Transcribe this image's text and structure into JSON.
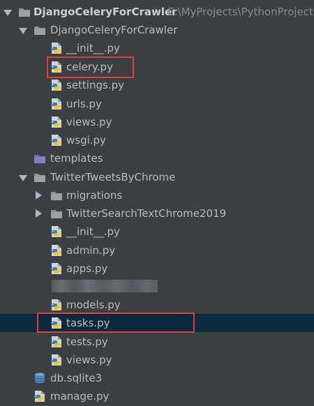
{
  "colors": {
    "background": "#3c3f41",
    "text": "#bbbbbb",
    "selection": "#0d293e",
    "highlight_box": "#e0403c",
    "folder": "#8d9297",
    "templates_folder": "#8a7cc2",
    "python_blue": "#3d7ab8",
    "python_yellow": "#f1c40f"
  },
  "tree": {
    "root": {
      "name": "DjangoCeleryForCrawler",
      "path": "E:\\MyProjects\\PythonProject",
      "icon": "folder-icon"
    },
    "items": [
      {
        "label": "DjangoCeleryForCrawler",
        "icon": "folder-icon",
        "expanded": true
      },
      {
        "label": "__init__.py",
        "icon": "python-file-icon"
      },
      {
        "label": "celery.py",
        "icon": "python-file-icon"
      },
      {
        "label": "settings.py",
        "icon": "python-file-icon"
      },
      {
        "label": "urls.py",
        "icon": "python-file-icon"
      },
      {
        "label": "views.py",
        "icon": "python-file-icon"
      },
      {
        "label": "wsgi.py",
        "icon": "python-file-icon"
      },
      {
        "label": "templates",
        "icon": "templates-folder-icon"
      },
      {
        "label": "TwitterTweetsByChrome",
        "icon": "folder-icon",
        "expanded": true
      },
      {
        "label": "migrations",
        "icon": "folder-icon",
        "expanded": false
      },
      {
        "label": "TwitterSearchTextChrome2019",
        "icon": "folder-icon",
        "expanded": false
      },
      {
        "label": "__init__.py",
        "icon": "python-file-icon"
      },
      {
        "label": "admin.py",
        "icon": "python-file-icon"
      },
      {
        "label": "apps.py",
        "icon": "python-file-icon"
      },
      {
        "label": "models.py",
        "icon": "python-file-icon"
      },
      {
        "label": "tasks.py",
        "icon": "python-file-icon",
        "selected": true
      },
      {
        "label": "tests.py",
        "icon": "python-file-icon"
      },
      {
        "label": "views.py",
        "icon": "python-file-icon"
      },
      {
        "label": "db.sqlite3",
        "icon": "database-icon"
      },
      {
        "label": "manage.py",
        "icon": "python-file-icon"
      }
    ]
  }
}
